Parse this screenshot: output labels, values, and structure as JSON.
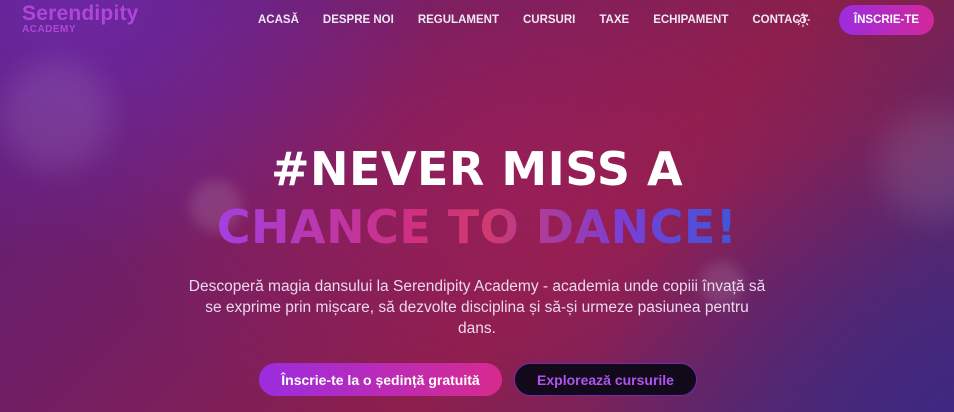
{
  "brand": {
    "name": "Serendipity",
    "subtitle": "ACADEMY"
  },
  "nav": {
    "items": [
      {
        "label": "ACASĂ"
      },
      {
        "label": "DESPRE NOI"
      },
      {
        "label": "REGULAMENT"
      },
      {
        "label": "CURSURI"
      },
      {
        "label": "TAXE"
      },
      {
        "label": "ECHIPAMENT"
      },
      {
        "label": "CONTACT"
      }
    ],
    "theme_toggle_icon": "sun-icon",
    "cta_label": "ÎNSCRIE-TE"
  },
  "hero": {
    "line1": "#NEVER MISS A",
    "line2": "CHANCE TO DANCE!",
    "description": "Descoperă magia dansului la Serendipity Academy - academia unde copiii învață să se exprime prin mișcare, să dezvolte disciplina și să-și urmeze pasiunea pentru dans.",
    "primary_button": "Înscrie-te la o ședință gratuită",
    "secondary_button": "Explorează cursurile"
  },
  "colors": {
    "accent_purple": "#9b2ce0",
    "accent_pink": "#d82a8e",
    "logo_purple": "#b046d8",
    "secondary_text": "#b054ef"
  }
}
